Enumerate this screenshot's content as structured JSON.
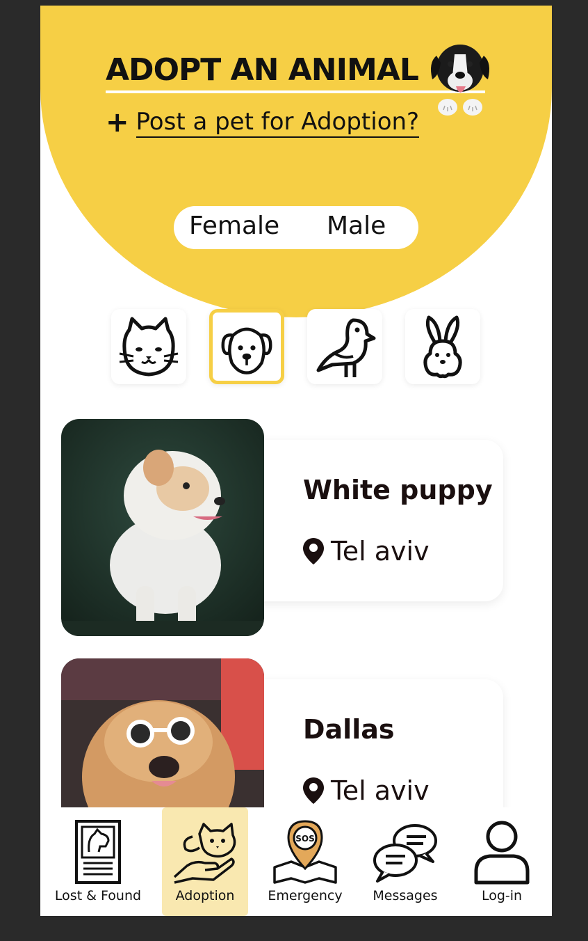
{
  "header": {
    "title": "ADOPT AN ANIMAL",
    "post_label": "Post a pet for Adoption?"
  },
  "gender_toggle": {
    "options": [
      "Female",
      "Male"
    ]
  },
  "categories": [
    {
      "name": "cat",
      "icon": "cat-icon"
    },
    {
      "name": "dog",
      "icon": "dog-icon",
      "selected": true
    },
    {
      "name": "bird",
      "icon": "bird-icon"
    },
    {
      "name": "rabbit",
      "icon": "rabbit-icon"
    }
  ],
  "pets": [
    {
      "name": "White puppy",
      "location": "Tel aviv"
    },
    {
      "name": "Dallas",
      "location": "Tel aviv"
    }
  ],
  "bottom_nav": {
    "items": [
      {
        "label": "Lost & Found",
        "icon": "lost-found-icon"
      },
      {
        "label": "Adoption",
        "icon": "adoption-icon",
        "active": true
      },
      {
        "label": "Emergency",
        "icon": "emergency-sos-icon"
      },
      {
        "label": "Messages",
        "icon": "messages-icon"
      },
      {
        "label": "Log-in",
        "icon": "user-icon"
      }
    ]
  },
  "colors": {
    "accent_yellow": "#f6cf45",
    "active_nav_bg": "#f9e8b0",
    "text_dark": "#111111"
  }
}
